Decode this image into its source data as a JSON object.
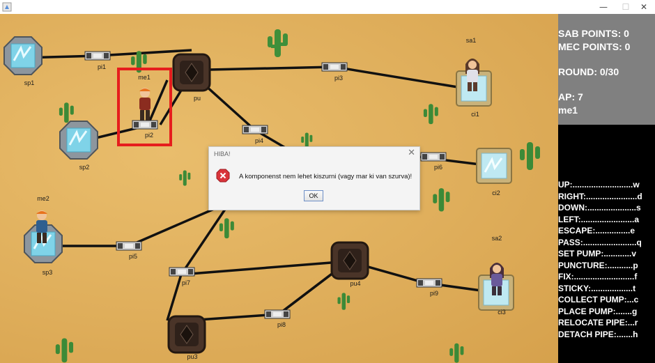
{
  "window": {
    "title": "",
    "minimize": "—",
    "maximize": "☐",
    "close": "✕"
  },
  "board": {
    "sources": [
      "sp1",
      "sp2",
      "sp3"
    ],
    "pumps": [
      "pu1",
      "pu3",
      "pu4"
    ],
    "cisterns": [
      "ci1",
      "ci2",
      "ci3"
    ],
    "pipes": [
      "pi1",
      "pi2",
      "pi3",
      "pi4",
      "pi5",
      "pi6",
      "pi7",
      "pi8",
      "pi9"
    ],
    "players": [
      "me1",
      "me2",
      "sa1",
      "sa2"
    ],
    "pump1_partial_label": "pu"
  },
  "scoreboard": {
    "sab_points": "SAB POINTS: 0",
    "mec_points": "MEC POINTS: 0",
    "round": "ROUND: 0/30",
    "ap": "AP: 7",
    "current_player": "me1"
  },
  "controls": [
    "UP:..........................w",
    "RIGHT:......................d",
    "DOWN:.....................s",
    "LEFT:.......................a",
    "ESCAPE:...............e",
    "PASS:.......................q",
    "SET PUMP:............v",
    "PUNCTURE:...........p",
    "FIX:..........................f",
    "STICKY:..................t",
    "COLLECT PUMP:...c",
    "PLACE PUMP:.......g",
    "RELOCATE PIPE:...r",
    "DETACH PIPE:.......h"
  ],
  "dialog": {
    "title": "HIBA!",
    "message": "A komponenst nem lehet kiszurni (vagy mar ki van szurva)!",
    "ok": "OK",
    "close": "✕"
  },
  "colors": {
    "sand": "#dfae5b",
    "selection": "#e61d1d",
    "sidebar_top": "#808080",
    "sidebar_bottom": "#000000",
    "error_icon": "#d9343a"
  }
}
